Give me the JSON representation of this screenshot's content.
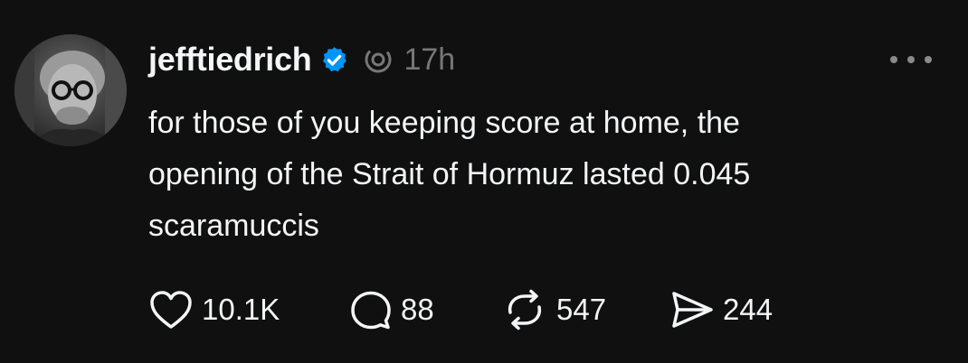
{
  "post": {
    "author": {
      "username": "jefftiedrich",
      "verified": true,
      "avatar_description": "black and white portrait, man with round glasses and grey hair"
    },
    "timestamp": "17h",
    "text_lines": [
      "for those of you keeping score at home, the",
      "opening of the Strait of Hormuz lasted 0.045",
      "scaramuccis"
    ],
    "actions": {
      "likes": "10.1K",
      "replies": "88",
      "reposts": "547",
      "shares": "244"
    }
  },
  "icons": {
    "verified": "verified-badge-icon",
    "threads": "threads-logo-icon",
    "more": "more-horizontal-icon",
    "like": "heart-icon",
    "reply": "comment-bubble-icon",
    "repost": "repost-arrows-icon",
    "share": "send-icon"
  },
  "colors": {
    "background": "#101010",
    "text": "#f3f5f7",
    "muted": "#777777",
    "verified": "#0095f6"
  }
}
